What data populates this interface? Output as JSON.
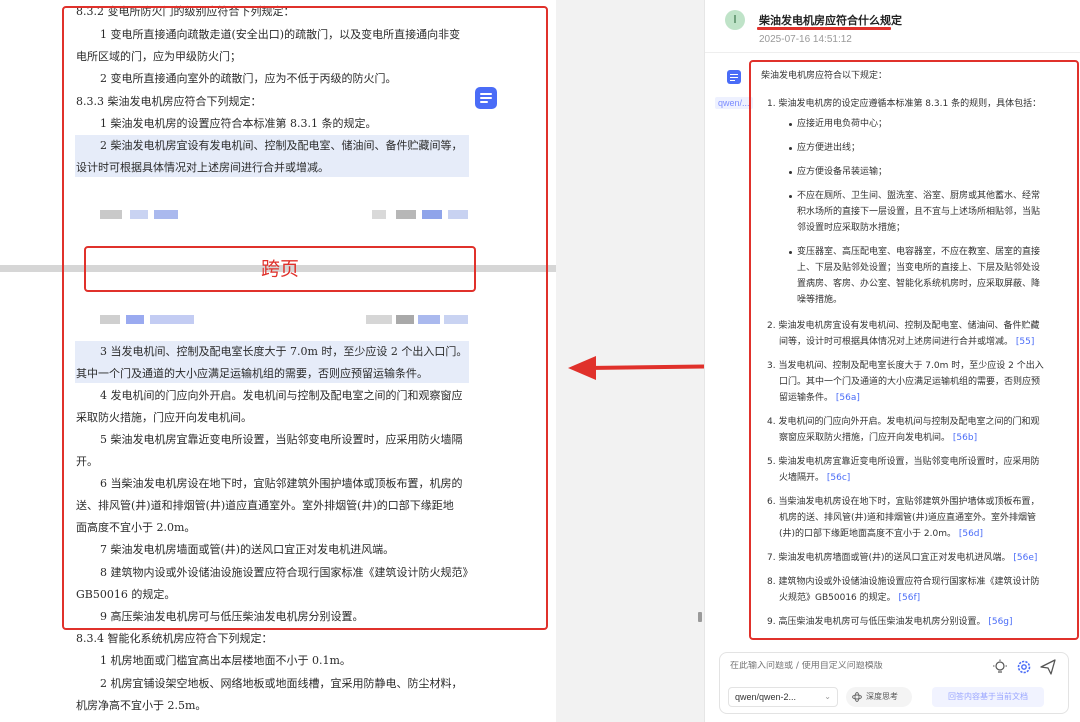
{
  "document": {
    "page1_lines": [
      "8.3.2 变电所防火门的级别应符合下列规定：",
      "1 变电所直接通向疏散走道(安全出口)的疏散门，以及变电所直接通向非变",
      "电所区域的门，应为甲级防火门；",
      "2 变电所直接通向室外的疏散门，应为不低于丙级的防火门。",
      "8.3.3 柴油发电机房应符合下列规定：",
      "1 柴油发电机房的设置应符合本标准第 8.3.1 条的规定。",
      "2 柴油发电机房宜设有发电机间、控制及配电室、储油间、备件贮藏间等，",
      "设计时可根据具体情况对上述房间进行合并或增减。"
    ],
    "cross_page_label": "跨页",
    "page2_lines": [
      "3 当发电机间、控制及配电室长度大于 7.0m 时，至少应设 2 个出入口门。",
      "其中一个门及通道的大小应满足运输机组的需要，否则应预留运输条件。",
      "4 发电机间的门应向外开启。发电机间与控制及配电室之间的门和观察窗应",
      "采取防火措施，门应开向发电机间。",
      "5 柴油发电机房宜靠近变电所设置，当贴邻变电所设置时，应采用防火墙隔",
      "开。",
      "6 当柴油发电机房设在地下时，宜贴邻建筑外围护墙体或顶板布置，机房的",
      "送、排风管(井)道和排烟管(井)道应直通室外。室外排烟管(井)的口部下缘距地",
      "面高度不宜小于 2.0m。",
      "7 柴油发电机房墙面或管(井)的送风口宜正对发电机进风端。",
      "8 建筑物内设或外设储油设施设置应符合现行国家标准《建筑设计防火规范》",
      "GB50016 的规定。",
      "9 高压柴油发电机房可与低压柴油发电机房分别设置。",
      "8.3.4 智能化系统机房应符合下列规定：",
      "1 机房地面或门槛宜高出本层楼地面不小于 0.1m。",
      "2 机房宜铺设架空地板、网络地板或地面线槽，宜采用防静电、防尘材料，",
      "机房净高不宜小于 2.5m。"
    ]
  },
  "chat": {
    "user_avatar": "I",
    "question": "柴油发电机房应符合什么规定",
    "timestamp": "2025-07-16 14:51:12",
    "model_tag": "qwen/...",
    "answer": {
      "intro": "柴油发电机房应符合以下规定：",
      "item1_lines": [
        "1. 柴油发电机房的设定应遵循本标准第 8.3.1 条的规则，具体包括："
      ],
      "bullets": [
        [
          "应接近用电负荷中心；"
        ],
        [
          "应方便进出线；"
        ],
        [
          "应方便设备吊装运输；"
        ],
        [
          "不应在厕所、卫生间、盥洗室、浴室、厨房或其他蓄水、经常",
          "积水场所的直接下一层设置，且不宜与上述场所相贴邻，当贴",
          "邻设置时应采取防水措施；"
        ],
        [
          "变压器室、高压配电室、电容器室，不应在教室、居室的直接",
          "上、下层及贴邻处设置；当变电所的直接上、下层及贴邻处设",
          "置病房、客房、办公室、智能化系统机房时，应采取屏蔽、降",
          "噪等措施。"
        ]
      ],
      "items": [
        {
          "lines": [
            "2. 柴油发电机房宜设有发电机间、控制及配电室、储油间、备件贮藏",
            "间等，设计时可根据具体情况对上述房间进行合并或增减。"
          ],
          "ref": "[55]"
        },
        {
          "lines": [
            "3. 当发电机间、控制及配电室长度大于 7.0m 时，至少应设 2 个出入",
            "口门。其中一个门及通道的大小应满足运输机组的需要，否则应预",
            "留运输条件。"
          ],
          "ref": "[56a]"
        },
        {
          "lines": [
            "4. 发电机间的门应向外开启。发电机间与控制及配电室之间的门和观",
            "察窗应采取防火措施，门应开向发电机间。"
          ],
          "ref": "[56b]"
        },
        {
          "lines": [
            "5. 柴油发电机房宜靠近变电所设置，当贴邻变电所设置时，应采用防",
            "火墙隔开。"
          ],
          "ref": "[56c]"
        },
        {
          "lines": [
            "6. 当柴油发电机房设在地下时，宜贴邻建筑外围护墙体或顶板布置，",
            "机房的送、排风管(井)道和排烟管(井)道应直通室外。室外排烟管",
            "(井)的口部下缘距地面高度不宜小于 2.0m。"
          ],
          "ref": "[56d]"
        },
        {
          "lines": [
            "7. 柴油发电机房墙面或管(井)的送风口宜正对发电机进风端。"
          ],
          "ref": "[56e]"
        },
        {
          "lines": [
            "8. 建筑物内设或外设储油设施设置应符合现行国家标准《建筑设计防",
            "火规范》GB50016 的规定。"
          ],
          "ref": "[56f]"
        },
        {
          "lines": [
            "9. 高压柴油发电机房可与低压柴油发电机房分别设置。"
          ],
          "ref": "[56g]"
        }
      ]
    },
    "input": {
      "placeholder": "在此输入问题或 / 使用自定义问题模版",
      "model": "qwen/qwen-2...",
      "deep_think": "深度思考",
      "doc_scope": "回答内容基于当前文档"
    }
  },
  "colors": {
    "accent": "#4a6cf7",
    "annotation_red": "#e0312b",
    "highlight": "#e6ecf9"
  }
}
